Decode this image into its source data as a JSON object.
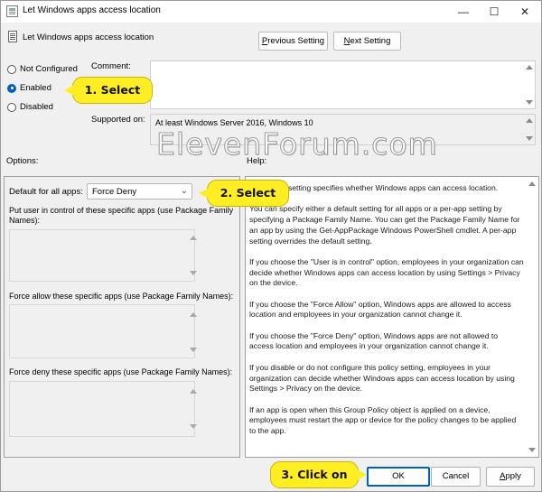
{
  "window": {
    "title": "Let Windows apps access location",
    "minimize_glyph": "—",
    "maximize_glyph": "☐",
    "close_glyph": "✕"
  },
  "header": {
    "title": "Let Windows apps access location",
    "previous_prefix": "P",
    "previous_rest": "revious Setting",
    "next_prefix": "N",
    "next_rest": "ext Setting"
  },
  "state": {
    "options": [
      {
        "prefix": "",
        "ul": "",
        "label": "Not Configured",
        "selected": false
      },
      {
        "label": "Enabled",
        "selected": true
      },
      {
        "label": "Disabled",
        "selected": false
      }
    ]
  },
  "comment_label": "Comment:",
  "supported_label": "Supported on:",
  "supported_value": "At least Windows Server 2016, Windows 10",
  "watermark": "ElevenForum.com",
  "options_label": "Options:",
  "help_label": "Help:",
  "options_panel": {
    "default_label": "Default for all apps:",
    "default_value": "Force Deny",
    "user_control_label": "Put user in control of these specific apps (use Package Family Names):",
    "force_allow_label": "Force allow these specific apps (use Package Family Names):",
    "force_deny_label": "Force deny these specific apps (use Package Family Names):"
  },
  "help_paragraphs": [
    "This policy setting specifies whether Windows apps can access location.",
    "You can specify either a default setting for all apps or a per-app setting by specifying a Package Family Name. You can get the Package Family Name for an app by using the Get-AppPackage Windows PowerShell cmdlet. A per-app setting overrides the default setting.",
    "If you choose the \"User is in control\" option, employees in your organization can decide whether Windows apps can access location by using Settings > Privacy on the device.",
    "If you choose the \"Force Allow\" option, Windows apps are allowed to access location and employees in your organization cannot change it.",
    "If you choose the \"Force Deny\" option, Windows apps are not allowed to access location and employees in your organization cannot change it.",
    "If you disable or do not configure this policy setting, employees in your organization can decide whether Windows apps can access location by using Settings > Privacy on the device.",
    "If an app is open when this Group Policy object is applied on a device, employees must restart the app or device for the policy changes to be applied to the app."
  ],
  "buttons": {
    "ok": "OK",
    "cancel": "Cancel",
    "apply_prefix": "A",
    "apply_rest": "pply"
  },
  "callouts": {
    "step1": "1. Select",
    "step2": "2. Select",
    "step3": "3. Click on"
  },
  "colors": {
    "callout": "#ffee24",
    "accent": "#0060c0"
  }
}
